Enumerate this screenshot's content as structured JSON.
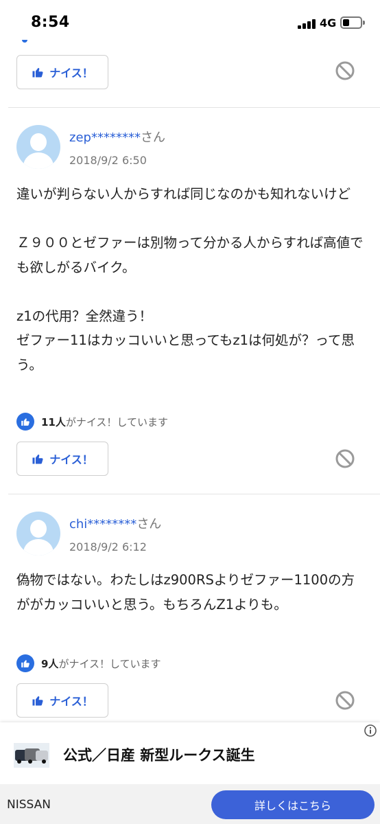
{
  "status_bar": {
    "time": "8:54",
    "network": "4G"
  },
  "nice_button_label": "ナイス！",
  "comments": [
    {
      "user": "zep********",
      "suffix": "さん",
      "date": "2018/9/2 6:50",
      "text": "違いが判らない人からすれば同じなのかも知れないけど\n\nＺ９００とゼファーは別物って分かる人からすれば高値でも欲しがるバイク。\n\nz1の代用？全然違う！\nゼファー11はカッコいいと思ってもz1は何処が？って思う。",
      "nice_count": "11人",
      "nice_suffix": "がナイス！しています"
    },
    {
      "user": "chi********",
      "suffix": "さん",
      "date": "2018/9/2 6:12",
      "text": "偽物ではない。わたしはz900RSよりゼファー1100の方ががカッコいいと思う。もちろんZ1よりも。",
      "nice_count": "9人",
      "nice_suffix": "がナイス！しています"
    }
  ],
  "ad": {
    "title": "公式／日産 新型ルークス誕生",
    "brand": "NISSAN",
    "cta": "詳しくはこちら"
  },
  "colors": {
    "accent": "#2a5fd6",
    "cta": "#3c62d8",
    "avatar": "#b8d9f5"
  }
}
